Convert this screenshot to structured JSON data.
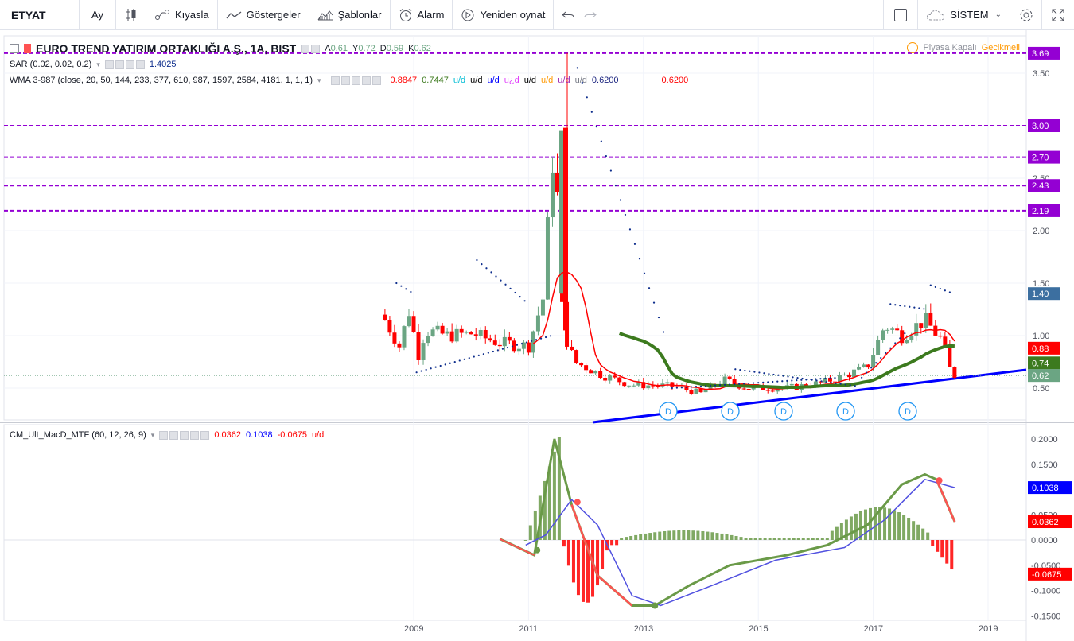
{
  "toolbar": {
    "symbol": "ETYAT",
    "interval": "Ay",
    "compare": "Kıyasla",
    "indicators": "Göstergeler",
    "templates": "Şablonlar",
    "alert": "Alarm",
    "replay": "Yeniden oynat",
    "theme": "SİSTEM",
    "icons": {
      "candles": "candlestick-icon",
      "compare": "compare-icon",
      "indicators": "indicators-icon",
      "templates": "templates-icon",
      "alert": "alarm-clock-icon",
      "replay": "replay-icon",
      "undo": "undo-icon",
      "redo": "redo-icon",
      "layout": "square-icon",
      "cloud": "cloud-icon",
      "settings": "gear-icon",
      "fullscreen": "fullscreen-icon"
    }
  },
  "legend": {
    "title": "EURO TREND YATIRIM ORTAKLIĞI A.Ş., 1A, BIST",
    "ohlc": {
      "o_label": "A",
      "o": "0.61",
      "h_label": "Y",
      "h": "0.72",
      "l_label": "D",
      "l": "0.59",
      "c_label": "K",
      "c": "0.62"
    },
    "status_market": "Piyasa Kapalı",
    "status_delay": "Gecikmeli",
    "sar": {
      "name": "SAR (0.02, 0.02, 0.2)",
      "value": "1.4025"
    },
    "wma": {
      "name": "WMA 3-987 (close, 20, 50, 144, 233, 377, 610, 987, 1597, 2584, 4181, 1, 1, 1)",
      "values": [
        "0.8847",
        "0.7447",
        "u/d",
        "u/d",
        "u/d",
        "u¿d",
        "u/d",
        "u/d",
        "u/d",
        "u/d",
        "0.6200",
        "0.6200"
      ]
    },
    "macd": {
      "name": "CM_Ult_MacD_MTF (60, 12, 26, 9)",
      "v1": "0.0362",
      "v2": "0.1038",
      "v3": "-0.0675",
      "v4": "u/d"
    }
  },
  "colors": {
    "up": "#6ba583",
    "down": "#ff0000",
    "hline": "#9400d3",
    "trend": "#0000ff",
    "wma20": "#ff0000",
    "wma50": "#3c7a1e",
    "sar": "#0d2d8c",
    "macd": "#6a9a48",
    "signal": "#5151e0"
  },
  "price_scale": {
    "ticks": [
      "3.50",
      "3.00",
      "2.50",
      "2.00",
      "1.50",
      "1.00",
      "0.50"
    ],
    "labels": [
      {
        "text": "3.69",
        "value": 3.69,
        "bg": "#9400d3"
      },
      {
        "text": "3.00",
        "value": 3.0,
        "bg": "#9400d3"
      },
      {
        "text": "2.70",
        "value": 2.7,
        "bg": "#9400d3"
      },
      {
        "text": "2.43",
        "value": 2.43,
        "bg": "#9400d3"
      },
      {
        "text": "2.19",
        "value": 2.19,
        "bg": "#9400d3"
      },
      {
        "text": "1.40",
        "value": 1.4,
        "bg": "#3c6fa0"
      },
      {
        "text": "0.88",
        "value": 0.88,
        "bg": "#ff0000"
      },
      {
        "text": "0.74",
        "value": 0.74,
        "bg": "#3c7a1e"
      },
      {
        "text": "0.62",
        "value": 0.62,
        "bg": "#6ba583"
      }
    ]
  },
  "macd_scale": {
    "ticks": [
      "0.2000",
      "0.1500",
      "0.1000",
      "0.0500",
      "0.0000",
      "-0.0500",
      "-0.1000",
      "-0.1500"
    ],
    "labels": [
      {
        "text": "0.1038",
        "value": 0.1038,
        "bg": "#0000ff"
      },
      {
        "text": "0.0362",
        "value": 0.0362,
        "bg": "#ff0000"
      },
      {
        "text": "-0.0675",
        "value": -0.0675,
        "bg": "#ff0000"
      }
    ]
  },
  "time_axis": [
    "2009",
    "2011",
    "2013",
    "2015",
    "2017",
    "2019"
  ],
  "dividend_markers": [
    "D",
    "D",
    "D",
    "D",
    "D"
  ],
  "chart_data": {
    "type": "candlestick",
    "title": "EURO TREND YATIRIM ORTAKLIĞI A.Ş., 1A, BIST",
    "interval": "1 month",
    "ylim": [
      0.3,
      3.75
    ],
    "horizontal_levels": [
      3.69,
      3.0,
      2.7,
      2.43,
      2.19
    ],
    "candles_approx": [
      {
        "date": "2008-06",
        "o": 1.2,
        "h": 1.22,
        "l": 0.85,
        "c": 0.9
      },
      {
        "date": "2008-09",
        "o": 0.9,
        "h": 1.5,
        "l": 0.62,
        "c": 1.3
      },
      {
        "date": "2008-12",
        "o": 1.3,
        "h": 1.75,
        "l": 0.65,
        "c": 0.72
      },
      {
        "date": "2009-06",
        "o": 0.95,
        "h": 1.15,
        "l": 0.9,
        "c": 1.05
      },
      {
        "date": "2010-06",
        "o": 1.02,
        "h": 1.06,
        "l": 0.88,
        "c": 0.92
      },
      {
        "date": "2011-03",
        "o": 0.85,
        "h": 1.45,
        "l": 0.8,
        "c": 1.4
      },
      {
        "date": "2011-06",
        "o": 1.4,
        "h": 3.0,
        "l": 1.3,
        "c": 2.95
      },
      {
        "date": "2011-08",
        "o": 2.95,
        "h": 3.69,
        "l": 0.9,
        "c": 1.05
      },
      {
        "date": "2012-06",
        "o": 0.7,
        "h": 0.75,
        "l": 0.6,
        "c": 0.62
      },
      {
        "date": "2013-06",
        "o": 0.52,
        "h": 0.58,
        "l": 0.48,
        "c": 0.5
      },
      {
        "date": "2014-06",
        "o": 0.52,
        "h": 0.62,
        "l": 0.45,
        "c": 0.55
      },
      {
        "date": "2015-06",
        "o": 0.5,
        "h": 0.56,
        "l": 0.45,
        "c": 0.48
      },
      {
        "date": "2016-06",
        "o": 0.55,
        "h": 0.7,
        "l": 0.5,
        "c": 0.62
      },
      {
        "date": "2017-06",
        "o": 0.95,
        "h": 1.3,
        "l": 0.8,
        "c": 1.1
      },
      {
        "date": "2017-12",
        "o": 1.0,
        "h": 1.5,
        "l": 0.85,
        "c": 1.2
      },
      {
        "date": "2018-04",
        "o": 0.8,
        "h": 0.85,
        "l": 0.6,
        "c": 0.65
      },
      {
        "date": "2018-05",
        "o": 0.61,
        "h": 0.72,
        "l": 0.59,
        "c": 0.62
      }
    ],
    "series": [
      {
        "name": "SAR",
        "last": 1.4025
      },
      {
        "name": "WMA 20",
        "last": 0.8847
      },
      {
        "name": "WMA 50",
        "last": 0.7447
      }
    ],
    "macd": {
      "macd": 0.1038,
      "signal": 0.0362,
      "histogram": -0.0675,
      "ylim": [
        -0.15,
        0.2
      ]
    }
  }
}
